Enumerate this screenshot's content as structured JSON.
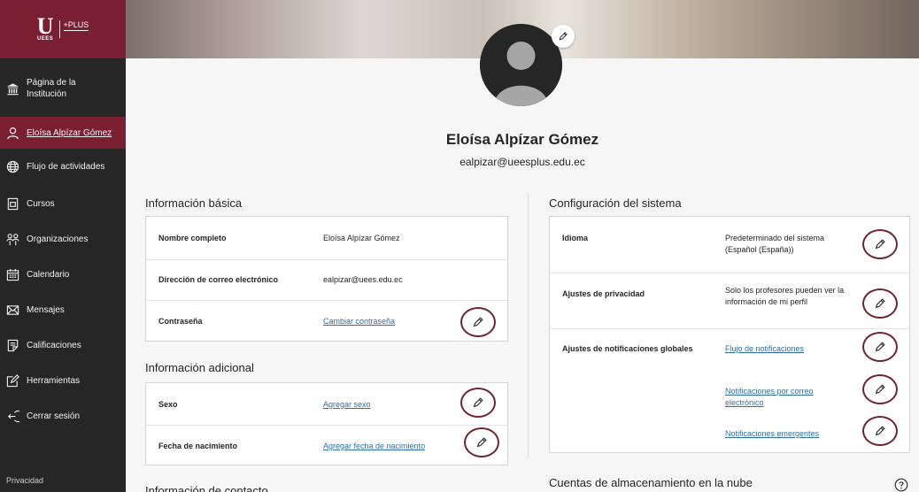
{
  "brand": {
    "logo_letter": "U",
    "logo_sub": "UEES",
    "logo_plus": "+PLUS"
  },
  "sidebar": {
    "items": [
      {
        "label": "Página de la Institución",
        "icon": "institution-icon"
      },
      {
        "label": "Eloísa Alpízar Gómez",
        "icon": "user-icon",
        "active": true
      },
      {
        "label": "Flujo de actividades",
        "icon": "globe-icon"
      },
      {
        "label": "Cursos",
        "icon": "courses-icon"
      },
      {
        "label": "Organizaciones",
        "icon": "organizations-icon"
      },
      {
        "label": "Calendario",
        "icon": "calendar-icon"
      },
      {
        "label": "Mensajes",
        "icon": "envelope-icon"
      },
      {
        "label": "Calificaciones",
        "icon": "grades-icon"
      },
      {
        "label": "Herramientas",
        "icon": "tools-icon"
      },
      {
        "label": "Cerrar sesión",
        "icon": "logout-icon"
      }
    ],
    "footer": "Privacidad"
  },
  "profile": {
    "name": "Eloísa Alpízar Gómez",
    "email": "ealpizar@ueesplus.edu.ec"
  },
  "basic_info": {
    "title": "Información básica",
    "rows": [
      {
        "label": "Nombre completo",
        "value": "Eloísa Alpízar Gómez"
      },
      {
        "label": "Dirección de correo electrónico",
        "value": "ealpizar@uees.edu.ec"
      },
      {
        "label": "Contraseña",
        "value": "Cambiar contraseña"
      }
    ]
  },
  "additional_info": {
    "title": "Información adicional",
    "rows": [
      {
        "label": "Sexo",
        "value": "Agregar sexo"
      },
      {
        "label": "Fecha de nacimiento",
        "value": "Agregar fecha de nacimiento"
      }
    ]
  },
  "contact_info": {
    "title": "Información de contacto"
  },
  "system_config": {
    "title": "Configuración del sistema",
    "rows": [
      {
        "label": "Idioma",
        "value": "Predeterminado del sistema (Español (España))"
      },
      {
        "label": "Ajustes de privacidad",
        "value": "Solo los profesores pueden ver la información de mi perfil"
      },
      {
        "label": "Ajustes de notificaciones globales",
        "links": [
          "Flujo de notificaciones",
          "Notificaciones por correo electrónico",
          "Notificaciones emergentes"
        ]
      }
    ]
  },
  "cloud": {
    "title": "Cuentas de almacenamiento en la nube"
  },
  "colors": {
    "brand": "#7a1f32",
    "sidebar": "#262626",
    "link": "#2f6fa8",
    "edit_ring": "#6e2530"
  }
}
